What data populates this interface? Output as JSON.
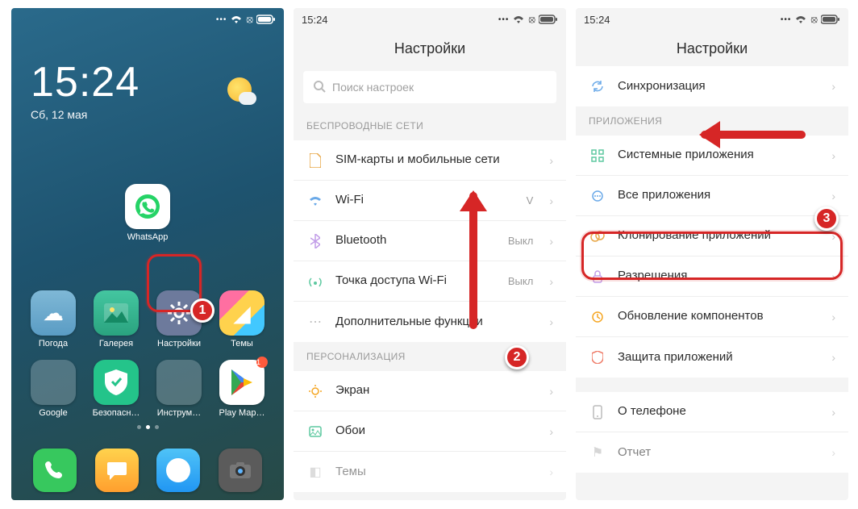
{
  "home": {
    "time": "15:24",
    "date": "Сб, 12 мая",
    "apps": {
      "whatsapp": "WhatsApp",
      "weather": "Погода",
      "gallery": "Галерея",
      "settings": "Настройки",
      "themes": "Темы",
      "google": "Google",
      "security": "Безопасн…",
      "tools": "Инструм…",
      "play": "Play Мар…"
    },
    "badges": {
      "play": "1"
    }
  },
  "screen2": {
    "statusbar_time": "15:24",
    "title": "Настройки",
    "search_placeholder": "Поиск настроек",
    "section_wireless": "БЕСПРОВОДНЫЕ СЕТИ",
    "sim": "SIM-карты и мобильные сети",
    "wifi": "Wi-Fi",
    "wifi_val": "V",
    "bt": "Bluetooth",
    "bt_val": "Выкл",
    "hotspot": "Точка доступа Wi-Fi",
    "hotspot_val": "Выкл",
    "more": "Дополнительные функции",
    "section_personal": "ПЕРСОНАЛИЗАЦИЯ",
    "display": "Экран",
    "wallpaper": "Обои",
    "themes": "Темы"
  },
  "screen3": {
    "statusbar_time": "15:24",
    "title": "Настройки",
    "sync": "Синхронизация",
    "section_apps": "ПРИЛОЖЕНИЯ",
    "system_apps": "Системные приложения",
    "all_apps": "Все приложения",
    "clone_apps": "Клонирование приложений",
    "permissions": "Разрешения",
    "updates": "Обновление компонентов",
    "protection": "Защита приложений",
    "about": "О телефоне",
    "report": "Отчет"
  },
  "markers": {
    "m1": "1",
    "m2": "2",
    "m3": "3"
  }
}
